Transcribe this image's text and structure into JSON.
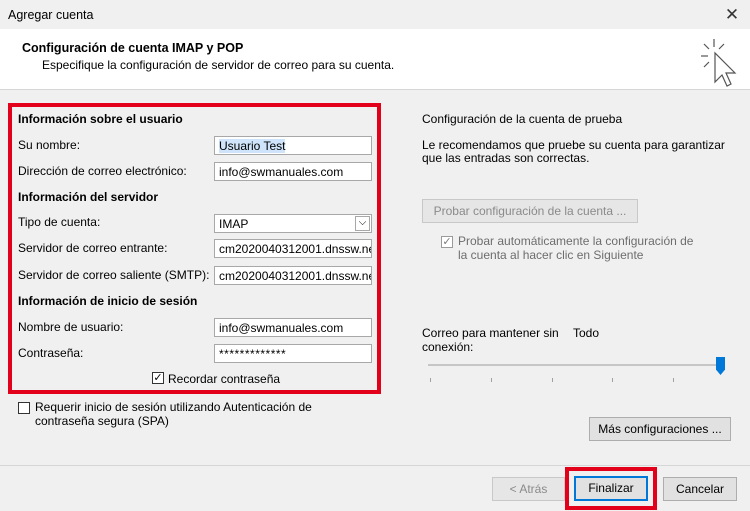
{
  "window": {
    "title": "Agregar cuenta",
    "close_glyph": "✕"
  },
  "header": {
    "title": "Configuración de cuenta IMAP y POP",
    "subtitle": "Especifique la configuración de servidor de correo para su cuenta.",
    "icon": "wizard-cursor-icon"
  },
  "user_info": {
    "section": "Información sobre el usuario",
    "name_label": "Su nombre:",
    "name_value": "Usuario Test",
    "email_label": "Dirección de correo electrónico:",
    "email_value": "info@swmanuales.com"
  },
  "server_info": {
    "section": "Información del servidor",
    "account_type_label": "Tipo de cuenta:",
    "account_type_value": "IMAP",
    "incoming_label": "Servidor de correo entrante:",
    "incoming_value": "cm2020040312001.dnssw.ne",
    "outgoing_label": "Servidor de correo saliente (SMTP):",
    "outgoing_value": "cm2020040312001.dnssw.ne"
  },
  "login_info": {
    "section": "Información de inicio de sesión",
    "username_label": "Nombre de usuario:",
    "username_value": "info@swmanuales.com",
    "password_label": "Contraseña:",
    "password_value": "*************",
    "remember_label": "Recordar contraseña",
    "remember_checked": true
  },
  "spa": {
    "label_line1": "Requerir inicio de sesión utilizando Autenticación de",
    "label_line2": "contraseña segura (SPA)",
    "checked": false
  },
  "test_panel": {
    "title": "Configuración de la cuenta de prueba",
    "desc_line1": "Le recomendamos que pruebe su cuenta para garantizar",
    "desc_line2": "que las entradas son correctas.",
    "test_button": "Probar configuración de la cuenta ...",
    "auto_test_line1": "Probar automáticamente la configuración de",
    "auto_test_line2": "la cuenta al hacer clic en Siguiente",
    "auto_test_checked": true
  },
  "offline": {
    "label_line1": "Correo para mantener sin",
    "label_line2": "conexión:",
    "value": "Todo",
    "slider_level": 1.0
  },
  "buttons": {
    "more_settings": "Más configuraciones ...",
    "back": "< Atrás",
    "finish": "Finalizar",
    "cancel": "Cancelar"
  },
  "colors": {
    "highlight_red": "#e3001b",
    "accent_blue": "#0078d7"
  }
}
